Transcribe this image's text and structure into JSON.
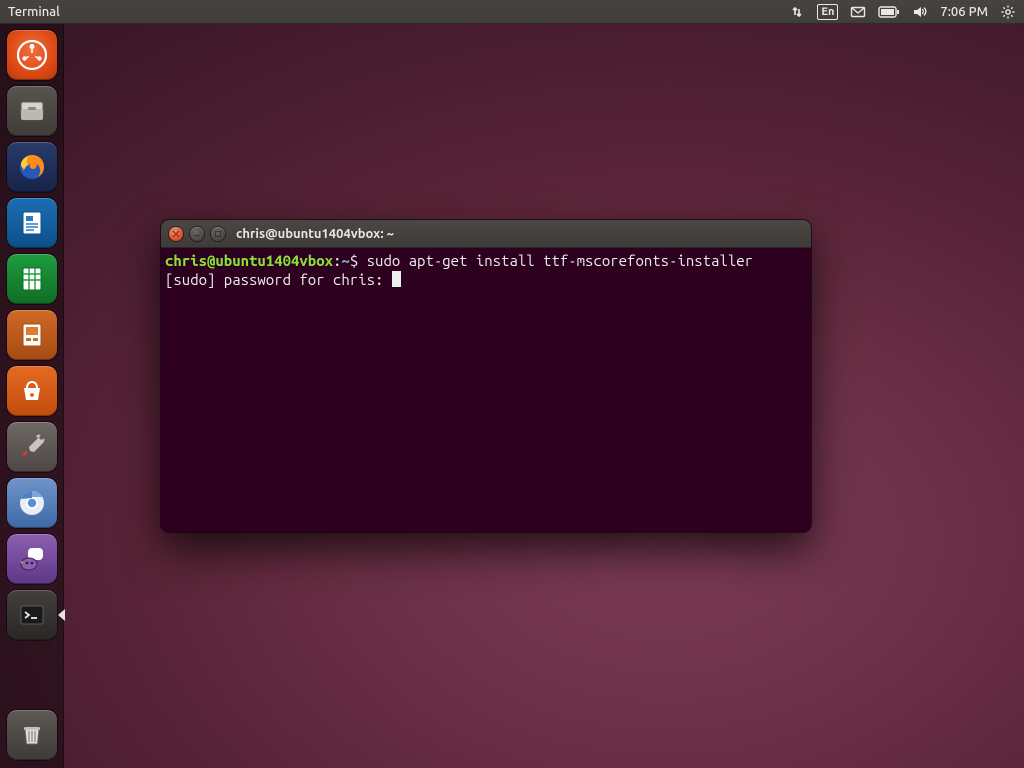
{
  "panel": {
    "app_name": "Terminal",
    "lang": "En",
    "clock": "7:06 PM"
  },
  "launcher": {
    "items": [
      {
        "name": "dash-icon",
        "label": "Dash"
      },
      {
        "name": "files-icon",
        "label": "Files"
      },
      {
        "name": "firefox-icon",
        "label": "Firefox"
      },
      {
        "name": "writer-icon",
        "label": "LibreOffice Writer"
      },
      {
        "name": "calc-icon",
        "label": "LibreOffice Calc"
      },
      {
        "name": "impress-icon",
        "label": "LibreOffice Impress"
      },
      {
        "name": "software-icon",
        "label": "Ubuntu Software"
      },
      {
        "name": "system-settings-icon",
        "label": "System Settings"
      },
      {
        "name": "chromium-icon",
        "label": "Chromium"
      },
      {
        "name": "pidgin-icon",
        "label": "Pidgin"
      },
      {
        "name": "terminal-icon",
        "label": "Terminal"
      }
    ],
    "trash_label": "Trash"
  },
  "terminal": {
    "title": "chris@ubuntu1404vbox: ~",
    "prompt_userhost": "chris@ubuntu1404vbox",
    "prompt_path": "~",
    "command": "sudo apt-get install ttf-mscorefonts-installer",
    "password_prompt": "[sudo] password for chris: "
  }
}
